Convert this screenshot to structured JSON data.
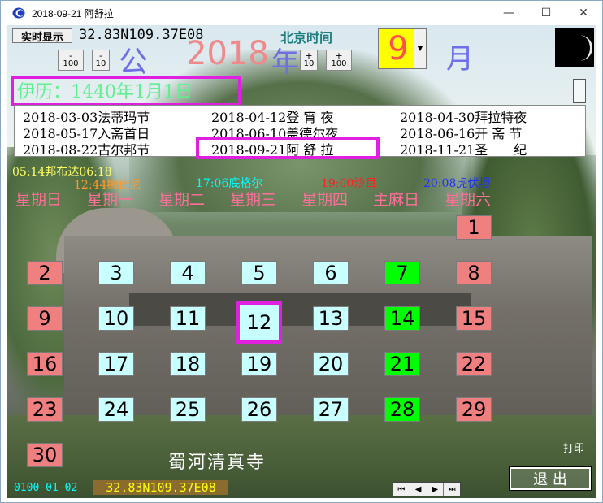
{
  "window": {
    "title": "2018-09-21 阿舒拉",
    "minimize": "—",
    "maximize": "☐",
    "close": "✕"
  },
  "toolbar": {
    "realtime_label": "实时显示",
    "coordinates": "32.83N109.37E08",
    "timezone": "北京时间",
    "minus100": "100",
    "minus10": "10",
    "plus10": "10",
    "plus100": "100",
    "minus_sign": "-",
    "plus_sign": "+",
    "era": "公",
    "year": "2018",
    "year_suffix": "年",
    "month": "9",
    "month_suffix": "月"
  },
  "hijri": {
    "date": "伊历：1440年1月1日"
  },
  "festivals": [
    "2018-03-03法蒂玛节",
    "2018-04-12登 宵 夜",
    "2018-04-30拜拉特夜",
    "2018-05-17入斋首日",
    "2018-06-10盖德尔夜",
    "2018-06-16开 斋 节",
    "2018-08-22古尔邦节",
    "2018-09-21阿 舒 拉",
    "2018-11-21圣　　纪"
  ],
  "prayer_times": [
    {
      "text": "05:14邦布达06:18",
      "color": "#ffff66"
    },
    {
      "text": "12:44撇仕尼",
      "color": "#ff9a2a"
    },
    {
      "text": "17:06底格尔",
      "color": "#00ffff"
    },
    {
      "text": "19:00沙目",
      "color": "#ff2020"
    },
    {
      "text": "20:08虎伏坦",
      "color": "#2030ff"
    }
  ],
  "weekdays": [
    "星期日",
    "星期一",
    "星期二",
    "星期三",
    "星期四",
    "主麻日",
    "星期六"
  ],
  "calendar": {
    "days": [
      "1",
      "2",
      "3",
      "4",
      "5",
      "6",
      "7",
      "8",
      "9",
      "10",
      "11",
      "12",
      "13",
      "14",
      "15",
      "16",
      "17",
      "18",
      "19",
      "20",
      "21",
      "22",
      "23",
      "24",
      "25",
      "26",
      "27",
      "28",
      "29",
      "30"
    ],
    "today": "12"
  },
  "caption": "蜀河清真寺",
  "print_label": "打印",
  "bottom_button": "退 出",
  "status": {
    "date": "0100-01-02",
    "coordinates": "32.83N109.37E08"
  },
  "nav": [
    "⏮",
    "◀",
    "▶",
    "⏭"
  ]
}
